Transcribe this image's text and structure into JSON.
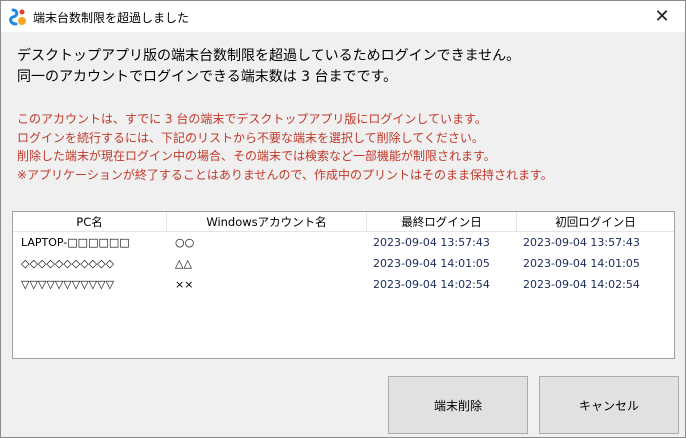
{
  "window": {
    "title": "端末台数制限を超過しました",
    "close_glyph": "✕"
  },
  "message": {
    "line1": "デスクトップアプリ版の端末台数制限を超過しているためログインできません。",
    "line2": "同一のアカウントでログインできる端末数は 3 台までです。"
  },
  "notice": {
    "line1": "このアカウントは、すでに 3 台の端末でデスクトップアプリ版にログインしています。",
    "line2": "ログインを続行するには、下記のリストから不要な端末を選択して削除してください。",
    "line3": "削除した端末が現在ログイン中の場合、その端末では検索など一部機能が制限されます。",
    "line4": "※アプリケーションが終了することはありませんので、作成中のプリントはそのまま保持されます。"
  },
  "table": {
    "headers": [
      "PC名",
      "Windowsアカウント名",
      "最終ログイン日",
      "初回ログイン日"
    ],
    "rows": [
      [
        "LAPTOP-□□□□□□",
        "○○",
        "2023-09-04 13:57:43",
        "2023-09-04 13:57:43"
      ],
      [
        "◇◇◇◇◇◇◇◇◇◇◇",
        "△△",
        "2023-09-04 14:01:05",
        "2023-09-04 14:01:05"
      ],
      [
        "▽▽▽▽▽▽▽▽▽▽▽",
        "××",
        "2023-09-04 14:02:54",
        "2023-09-04 14:02:54"
      ]
    ]
  },
  "buttons": {
    "delete_label": "端末削除",
    "cancel_label": "キャンセル"
  },
  "colors": {
    "notice_red": "#c0392b",
    "background": "#f0f0f0",
    "button_face": "#e1e1e1"
  }
}
